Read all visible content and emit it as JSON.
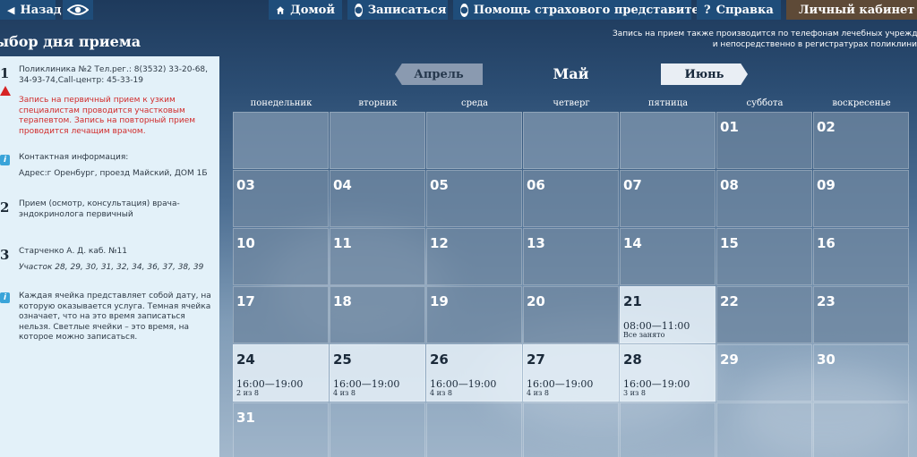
{
  "topbar": {
    "back_label": "Назад",
    "home_label": "Домой",
    "signup_label": "Записаться",
    "help_rep_label": "Помощь страхового представителя",
    "help_label": "Справка",
    "cabinet_label": "Личный кабинет"
  },
  "page_title": "ыбор дня приема",
  "top_note_line1": "Запись на прием также производится по телефонам лечебных учреждений",
  "top_note_line2": "и непосредственно в регистратурах поликлини",
  "sidebar": {
    "block1_num": "1",
    "block1_text": "Поликлиника №2 Тел.рег.: 8(3532) 33-20-68, 34-93-74,Call-центр: 45-33-19",
    "warning_text": "Запись на первичный прием к узким специалистам проводится участковым терапевтом. Запись на повторный прием проводится лечащим врачом.",
    "contact_title": "Контактная информация:",
    "contact_address": "Адрес:г Оренбург, проезд Майский, ДОМ 1Б",
    "block2_num": "2",
    "block2_text": "Прием (осмотр, консультация) врача-эндокринолога первичный",
    "block3_num": "3",
    "block3_text": "Старченко А. Д. каб. №11",
    "block3_area": "Участок 28, 29, 30, 31, 32, 34, 36, 37, 38, 39",
    "legend_text": "Каждая ячейка представляет собой дату, на которую оказывается услуга. Темная ячейка означает, что на это время записаться нельзя. Светлые ячейки – это время, на которое можно записаться."
  },
  "calendar": {
    "prev_month": "Апрель",
    "current_month": "Май",
    "next_month": "Июнь",
    "weekdays": [
      "понедельник",
      "вторник",
      "среда",
      "четверг",
      "пятница",
      "суббота",
      "воскресенье"
    ],
    "days": [
      {
        "n": "",
        "t": "",
        "s": "",
        "state": "empty"
      },
      {
        "n": "",
        "t": "",
        "s": "",
        "state": "empty"
      },
      {
        "n": "",
        "t": "",
        "s": "",
        "state": "empty"
      },
      {
        "n": "",
        "t": "",
        "s": "",
        "state": "empty"
      },
      {
        "n": "",
        "t": "",
        "s": "",
        "state": "empty"
      },
      {
        "n": "01",
        "t": "",
        "s": "",
        "state": "dark"
      },
      {
        "n": "02",
        "t": "",
        "s": "",
        "state": "dark"
      },
      {
        "n": "03",
        "t": "",
        "s": "",
        "state": "dark"
      },
      {
        "n": "04",
        "t": "",
        "s": "",
        "state": "dark"
      },
      {
        "n": "05",
        "t": "",
        "s": "",
        "state": "dark"
      },
      {
        "n": "06",
        "t": "",
        "s": "",
        "state": "dark"
      },
      {
        "n": "07",
        "t": "",
        "s": "",
        "state": "dark"
      },
      {
        "n": "08",
        "t": "",
        "s": "",
        "state": "dark"
      },
      {
        "n": "09",
        "t": "",
        "s": "",
        "state": "dark"
      },
      {
        "n": "10",
        "t": "",
        "s": "",
        "state": "dark"
      },
      {
        "n": "11",
        "t": "",
        "s": "",
        "state": "dark"
      },
      {
        "n": "12",
        "t": "",
        "s": "",
        "state": "dark"
      },
      {
        "n": "13",
        "t": "",
        "s": "",
        "state": "dark"
      },
      {
        "n": "14",
        "t": "",
        "s": "",
        "state": "dark"
      },
      {
        "n": "15",
        "t": "",
        "s": "",
        "state": "dark"
      },
      {
        "n": "16",
        "t": "",
        "s": "",
        "state": "dark"
      },
      {
        "n": "17",
        "t": "",
        "s": "",
        "state": "dark"
      },
      {
        "n": "18",
        "t": "",
        "s": "",
        "state": "dark"
      },
      {
        "n": "19",
        "t": "",
        "s": "",
        "state": "dark"
      },
      {
        "n": "20",
        "t": "",
        "s": "",
        "state": "dark"
      },
      {
        "n": "21",
        "t": "08:00—11:00",
        "s": "Все занято",
        "state": "light"
      },
      {
        "n": "22",
        "t": "",
        "s": "",
        "state": "dark"
      },
      {
        "n": "23",
        "t": "",
        "s": "",
        "state": "dark"
      },
      {
        "n": "24",
        "t": "16:00—19:00",
        "s": "2 из 8",
        "state": "light"
      },
      {
        "n": "25",
        "t": "16:00—19:00",
        "s": "4 из 8",
        "state": "light"
      },
      {
        "n": "26",
        "t": "16:00—19:00",
        "s": "4 из 8",
        "state": "light"
      },
      {
        "n": "27",
        "t": "16:00—19:00",
        "s": "4 из 8",
        "state": "light"
      },
      {
        "n": "28",
        "t": "16:00—19:00",
        "s": "3 из 8",
        "state": "light"
      },
      {
        "n": "29",
        "t": "",
        "s": "",
        "state": "past"
      },
      {
        "n": "30",
        "t": "",
        "s": "",
        "state": "past"
      },
      {
        "n": "31",
        "t": "",
        "s": "",
        "state": "past"
      },
      {
        "n": "",
        "t": "",
        "s": "",
        "state": "past"
      },
      {
        "n": "",
        "t": "",
        "s": "",
        "state": "past"
      },
      {
        "n": "",
        "t": "",
        "s": "",
        "state": "past"
      },
      {
        "n": "",
        "t": "",
        "s": "",
        "state": "past"
      },
      {
        "n": "",
        "t": "",
        "s": "",
        "state": "past"
      },
      {
        "n": "",
        "t": "",
        "s": "",
        "state": "past"
      }
    ]
  }
}
